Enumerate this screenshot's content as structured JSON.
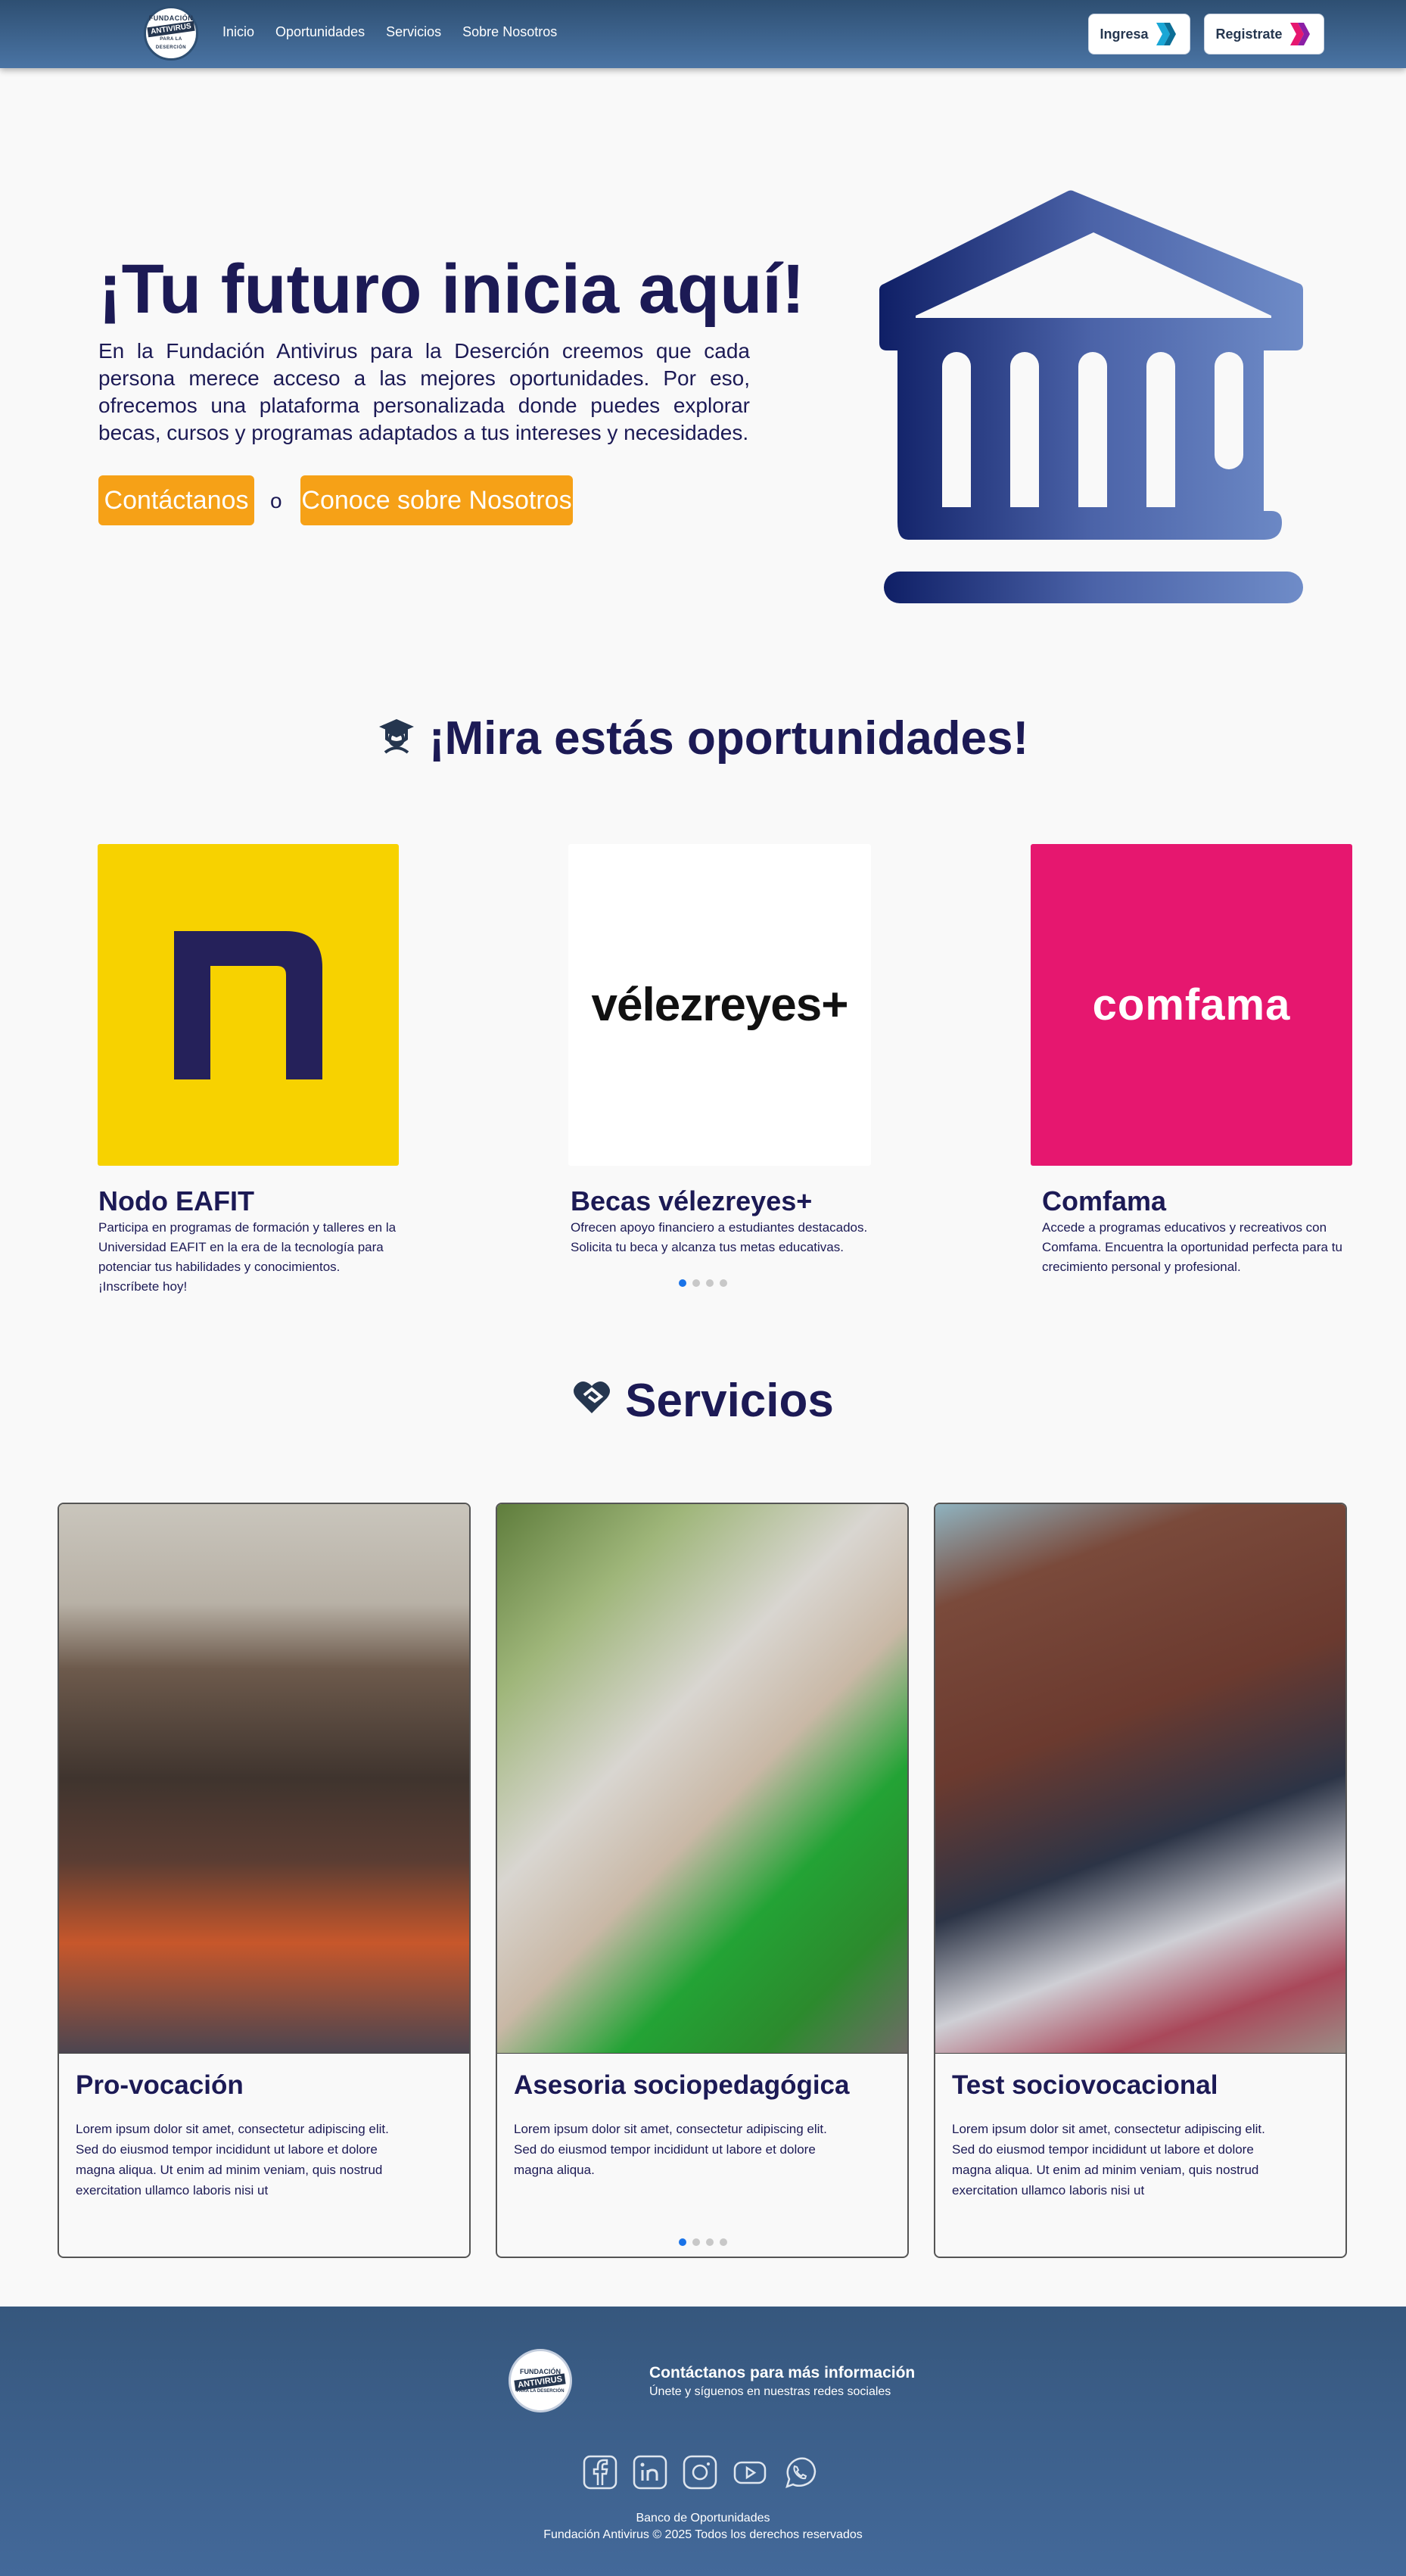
{
  "nav": {
    "logo_ring": "FUNDACIÓN",
    "logo_band": "ANTIVIRUS",
    "logo_bottom": "PARA LA DESERCIÓN",
    "links": [
      "Inicio",
      "Oportunidades",
      "Servicios",
      "Sobre Nosotros"
    ],
    "ingresa_label": "Ingresa",
    "registrate_label": "Registrate"
  },
  "hero": {
    "title": "¡Tu futuro inicia aquí!",
    "text": "En la Fundación Antivirus para la Deserción creemos que cada persona merece acceso a las mejores oportunidades. Por eso, ofrecemos una plataforma personalizada donde puedes explorar becas, cursos y programas adaptados a tus intereses y necesidades.",
    "contact_label": "Contáctanos",
    "or_label": "o",
    "about_label": "Conoce sobre Nosotros",
    "icon": "institution-icon"
  },
  "opportunities": {
    "title": "¡Mira estás oportunidades!",
    "icon": "graduate-icon",
    "items": [
      {
        "name": "Nodo EAFIT",
        "logo_text": "n",
        "bg": "#f7d200",
        "desc": "Participa en programas de formación y talleres en la Universidad EAFIT en la era de la tecnología para potenciar tus habilidades y conocimientos. ¡Inscríbete hoy!"
      },
      {
        "name": "Becas vélezreyes+",
        "logo_text": "vélezreyes+",
        "bg": "#ffffff",
        "desc": "Ofrecen apoyo financiero a estudiantes destacados. Solicita tu beca y alcanza tus metas educativas."
      },
      {
        "name": "Comfama",
        "logo_text": "comfama",
        "bg": "#e6176f",
        "desc": "Accede a programas educativos y recreativos con Comfama. Encuentra la oportunidad perfecta para tu crecimiento personal y profesional."
      }
    ]
  },
  "services": {
    "title": "Servicios",
    "icon": "heart-handshake-icon",
    "items": [
      {
        "title": "Pro-vocación",
        "text": "Lorem ipsum dolor sit amet, consectetur adipiscing elit. Sed do eiusmod tempor incididunt ut labore et dolore magna aliqua. Ut enim ad minim veniam, quis nostrud exercitation ullamco laboris nisi ut"
      },
      {
        "title": "Asesoria sociopedagógica",
        "text": "Lorem ipsum dolor sit amet, consectetur adipiscing elit. Sed do eiusmod tempor incididunt ut labore et dolore magna aliqua."
      },
      {
        "title": "Test sociovocacional",
        "text": "Lorem ipsum dolor sit amet, consectetur adipiscing elit. Sed do eiusmod tempor incididunt ut labore et dolore magna aliqua. Ut enim ad minim veniam, quis nostrud exercitation ullamco laboris nisi ut"
      }
    ]
  },
  "footer": {
    "contact_title": "Contáctanos para más información",
    "contact_sub": "Únete y síguenos en nuestras redes sociales",
    "socials": [
      "facebook-icon",
      "linkedin-icon",
      "instagram-icon",
      "youtube-icon",
      "whatsapp-icon"
    ],
    "bank": "Banco de Oportunidades",
    "copyright": "Fundación Antivirus © 2025 Todos los derechos reservados"
  },
  "colors": {
    "primary": "#1c1a55",
    "accent": "#f6a117",
    "nav": "#3a5f8a",
    "dot_active": "#1a73e8"
  }
}
